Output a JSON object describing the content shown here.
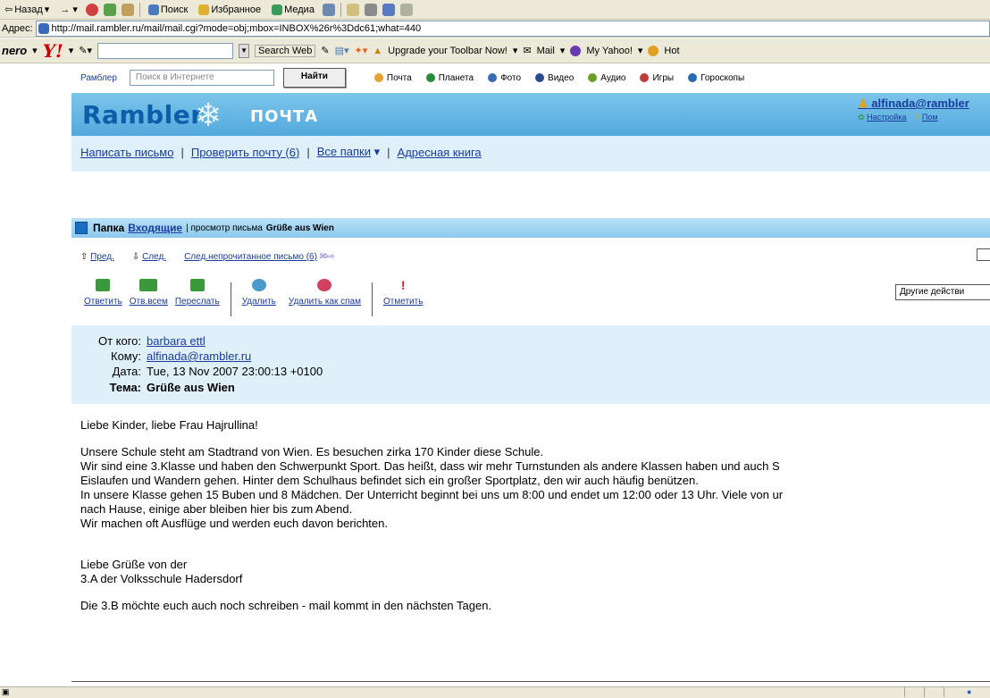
{
  "browser": {
    "toolbar": [
      "Назад",
      "Поиск",
      "Избранное",
      "Медиа"
    ],
    "address_label": "Адрес:",
    "url": "http://mail.rambler.ru/mail/mail.cgi?mode=obj;mbox=INBOX%26r%3Ddc61;what=440"
  },
  "yahoo_toolbar": {
    "nero": "nero",
    "yahoo_logo": "Y!",
    "search_button": "Search Web",
    "upgrade": "Upgrade your Toolbar Now!",
    "mail": "Mail",
    "my_yahoo": "My Yahoo!",
    "hot": "Hot"
  },
  "rambler_top": {
    "brand": "Рамблер",
    "search_placeholder": "Поиск в Интернете",
    "find_button": "Найти",
    "services": [
      {
        "label": "Почта",
        "color": "#e8a030"
      },
      {
        "label": "Планета",
        "color": "#2a8a3a"
      },
      {
        "label": "Фото",
        "color": "#3a6ab0"
      },
      {
        "label": "Видео",
        "color": "#2a4a90"
      },
      {
        "label": "Аудио",
        "color": "#6aa02a"
      },
      {
        "label": "Игры",
        "color": "#c03a3a"
      },
      {
        "label": "Гороскопы",
        "color": "#2a6ab0"
      }
    ]
  },
  "header": {
    "logo": "Rambler",
    "mail_word": "ПОЧТА",
    "user": "alfinada@rambler",
    "settings": "Настройка",
    "help": "Пом"
  },
  "nav": {
    "compose": "Написать письмо",
    "check": "Проверить почту (6)",
    "folders": "Все папки",
    "address_book": "Адресная книга"
  },
  "folder_bar": {
    "label": "Папка",
    "folder": "Входящие",
    "viewing": "| просмотр письма",
    "subject": "Grüße aus Wien"
  },
  "message_nav": {
    "prev": "Пред.",
    "next": "След.",
    "next_unread": "След.непрочитанное письмо (6)"
  },
  "actions": {
    "reply": "Ответить",
    "reply_all": "Отв.всем",
    "forward": "Переслать",
    "delete": "Удалить",
    "delete_spam": "Удалить как спам",
    "mark": "Отметить",
    "other": "Другие действи"
  },
  "headers": {
    "from_label": "От кого:",
    "from": "barbara ettl",
    "to_label": "Кому:",
    "to": "alfinada@rambler.ru",
    "date_label": "Дата:",
    "date": "Tue, 13 Nov 2007 23:00:13 +0100",
    "subject_label": "Тема:",
    "subject": "Grüße aus Wien"
  },
  "body": {
    "greeting": "Liebe Kinder, liebe Frau Hajrullina!",
    "p1": "Unsere Schule steht am Stadtrand von Wien. Es besuchen zirka 170 Kinder diese Schule.",
    "p2": "Wir sind eine 3.Klasse und haben den Schwerpunkt Sport. Das heißt, dass wir mehr Turnstunden als andere Klassen haben und auch S",
    "p3": "Eislaufen und Wandern gehen. Hinter dem Schulhaus befindet sich ein großer Sportplatz, den wir auch häufig benützen.",
    "p4": "In unsere Klasse gehen 15 Buben und 8 Mädchen. Der Unterricht beginnt bei uns um 8:00 und endet um 12:00 oder 13 Uhr. Viele von ur",
    "p5": "nach Hause, einige aber bleiben hier bis zum Abend.",
    "p6": "Wir machen oft Ausflüge und werden euch davon berichten.",
    "sign1": "Liebe Grüße von der",
    "sign2": "3.A der Volksschule Hadersdorf",
    "ps": "Die 3.B möchte euch auch noch schreiben - mail kommt in den nächsten Tagen."
  }
}
